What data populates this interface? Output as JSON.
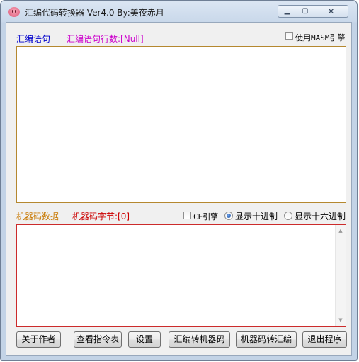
{
  "window": {
    "title": "汇编代码转换器 Ver4.0  By:美夜赤月",
    "min_glyph": "▁",
    "max_glyph": "▢",
    "close_glyph": "✕"
  },
  "asm_section": {
    "label": "汇编语句",
    "count_label": "汇编语句行数:[Null]",
    "masm_checkbox_label": "使用MASM引擎",
    "masm_checked": false,
    "text": ""
  },
  "machine_section": {
    "label": "机器码数据",
    "bytes_label": "机器码字节:[0]",
    "ce_checkbox_label": "CE引擎",
    "ce_checked": false,
    "radio_decimal_label": "显示十进制",
    "radio_hex_label": "显示十六进制",
    "selected_radio": "decimal",
    "text": "",
    "scroll_up": "▲",
    "scroll_down": "▼"
  },
  "buttons": {
    "about": "关于作者",
    "instructions": "查看指令表",
    "settings": "设置",
    "asm_to_machine": "汇编转机器码",
    "machine_to_asm": "机器码转汇编",
    "exit": "退出程序"
  },
  "colors": {
    "asm_label": "#0000cc",
    "count_label": "#cc00cc",
    "machine_label": "#c87800",
    "bytes_label": "#cc0000",
    "asm_border": "#b5882f",
    "machine_border": "#cc2b2b"
  }
}
